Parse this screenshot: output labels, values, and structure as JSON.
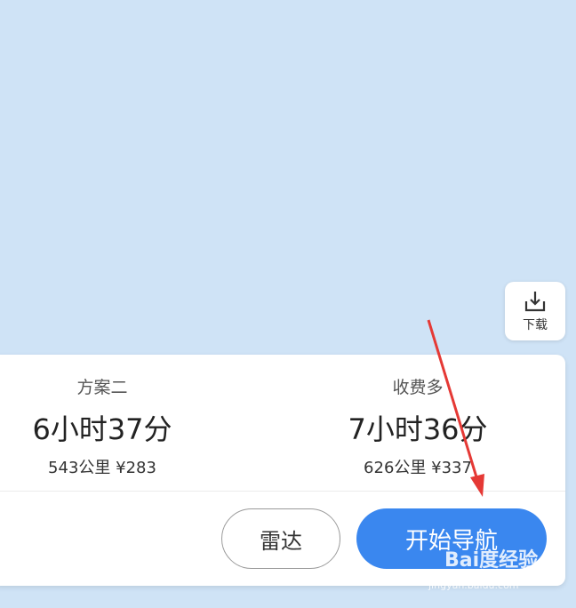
{
  "map": {
    "download_label": "下载"
  },
  "routes": [
    {
      "name": "方案二",
      "time": "6小时37分",
      "distance": "543公里",
      "cost": "¥283"
    },
    {
      "name": "收费多",
      "time": "7小时36分",
      "distance": "626公里",
      "cost": "¥337"
    }
  ],
  "actions": {
    "radar_label": "雷达",
    "start_nav_label": "开始导航"
  },
  "watermark": {
    "brand": "Bai度经验",
    "url": "jingyan.baidu.com"
  },
  "colors": {
    "accent": "#3a87ef",
    "annotation_arrow": "#e53935",
    "map_bg": "#cfe3f6"
  }
}
